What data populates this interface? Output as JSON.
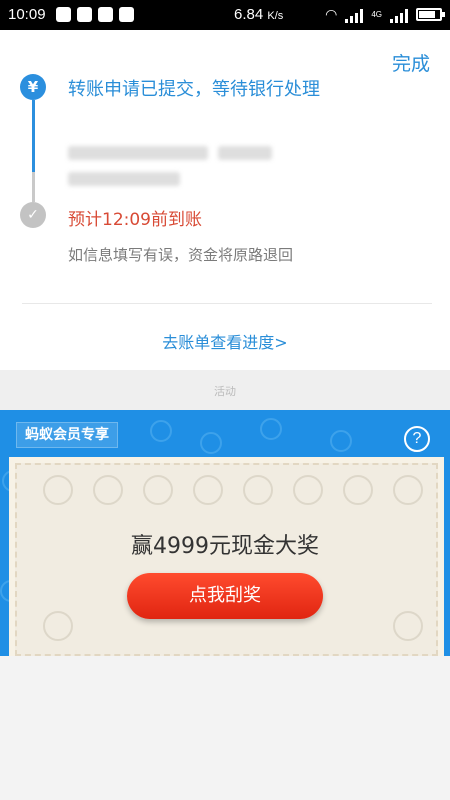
{
  "status_bar": {
    "time": "10:09",
    "speed": "6.84",
    "speed_unit": "K/s",
    "network": "4G"
  },
  "header": {
    "done_label": "完成"
  },
  "timeline": {
    "step1_icon": "yuan-icon",
    "step1_text": "转账申请已提交，等待银行处理",
    "step2_icon": "check-icon",
    "step2_text": "预计12:09前到账",
    "note": "如信息填写有误，资金将原路退回",
    "active_color": "#2b8fde",
    "inactive_color": "#c3c3c3",
    "eta_color": "#d84a35"
  },
  "progress_link": "去账单查看进度>",
  "activity_label": "活动",
  "promo": {
    "member_tag": "蚂蚁会员专享",
    "help_symbol": "?",
    "prize_text": "赢4999元现金大奖",
    "scratch_button": "点我刮奖",
    "banner_color": "#1f8fe5"
  }
}
